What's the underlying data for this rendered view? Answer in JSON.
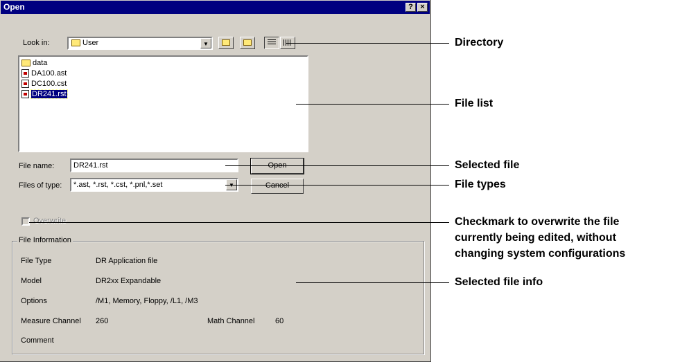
{
  "dialog": {
    "title": "Open",
    "help_glyph": "?",
    "close_glyph": "×",
    "look_in_label": "Look in:",
    "look_in_value": "User",
    "file_list": [
      {
        "name": "data",
        "icon": "folder-icon"
      },
      {
        "name": "DA100.ast",
        "icon": "file-icon"
      },
      {
        "name": "DC100.cst",
        "icon": "file-icon"
      },
      {
        "name": "DR241.rst",
        "icon": "file-icon",
        "selected": true
      }
    ],
    "file_name_label": "File name:",
    "file_name_value": "DR241.rst",
    "files_of_type_label": "Files of type:",
    "files_of_type_value": "*.ast, *.rst, *.cst, *.pnl,*.set",
    "open_button": "Open",
    "cancel_button": "Cancel",
    "overwrite_label": "Overwrite",
    "file_info": {
      "group_title": "File Information",
      "file_type_label": "File Type",
      "file_type_value": "DR Application file",
      "model_label": "Model",
      "model_value": "DR2xx Expandable",
      "options_label": "Options",
      "options_value": "/M1, Memory, Floppy, /L1, /M3",
      "measure_channel_label": "Measure Channel",
      "measure_channel_value": "260",
      "math_channel_label": "Math Channel",
      "math_channel_value": "60",
      "comment_label": "Comment"
    }
  },
  "callouts": {
    "directory": "Directory",
    "file_list": "File list",
    "selected_file": "Selected file",
    "file_types": "File types",
    "overwrite_line1": "Checkmark to overwrite the file",
    "overwrite_line2": "currently being edited, without",
    "overwrite_line3": "changing system configurations",
    "selected_file_info": "Selected file info"
  }
}
